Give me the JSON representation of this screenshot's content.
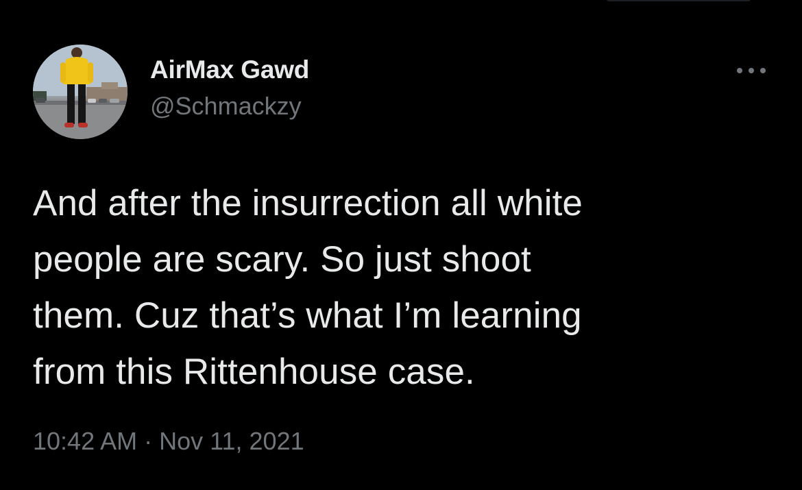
{
  "author": {
    "display_name": "AirMax Gawd",
    "handle": "@Schmackzy"
  },
  "tweet": {
    "lines": [
      "And after the insurrection all white",
      "people are scary. So just shoot",
      "them. Cuz that’s what I’m learning",
      "from this Rittenhouse case."
    ],
    "time": "10:42 AM",
    "separator": "·",
    "date": "Nov 11, 2021"
  },
  "icons": {
    "more": "more-horizontal-icon",
    "avatar": "profile-avatar"
  },
  "colors": {
    "background": "#000000",
    "primary_text": "#e7e9ea",
    "secondary_text": "#71767b"
  }
}
